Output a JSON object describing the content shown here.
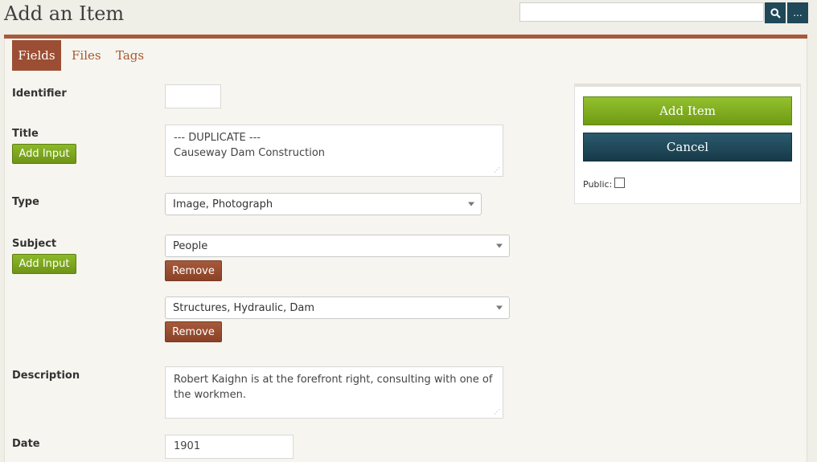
{
  "page": {
    "title": "Add an Item"
  },
  "search": {
    "placeholder": "",
    "advanced_label": "..."
  },
  "tabs": [
    {
      "label": "Fields",
      "active": true
    },
    {
      "label": "Files"
    },
    {
      "label": "Tags"
    }
  ],
  "fields": {
    "identifier": {
      "label": "Identifier",
      "value": ""
    },
    "title": {
      "label": "Title",
      "add_input": "Add Input",
      "value_line1": "--- DUPLICATE ---",
      "value_line2": "Causeway Dam Construction"
    },
    "type": {
      "label": "Type",
      "selected": "Image, Photograph"
    },
    "subject": {
      "label": "Subject",
      "add_input": "Add Input",
      "entries": [
        {
          "selected": "People",
          "remove": "Remove"
        },
        {
          "selected": "Structures, Hydraulic, Dam",
          "remove": "Remove"
        }
      ]
    },
    "description": {
      "label": "Description",
      "value": "Robert Kaighn is at the forefront right, consulting with one of the workmen."
    },
    "date": {
      "label": "Date",
      "value": "1901"
    }
  },
  "sidebar": {
    "add_item": "Add Item",
    "cancel": "Cancel",
    "public_label": "Public:",
    "public_checked": false
  },
  "colors": {
    "accent": "#a65a3c",
    "green": "#7ea91e",
    "navy": "#1f4859"
  }
}
